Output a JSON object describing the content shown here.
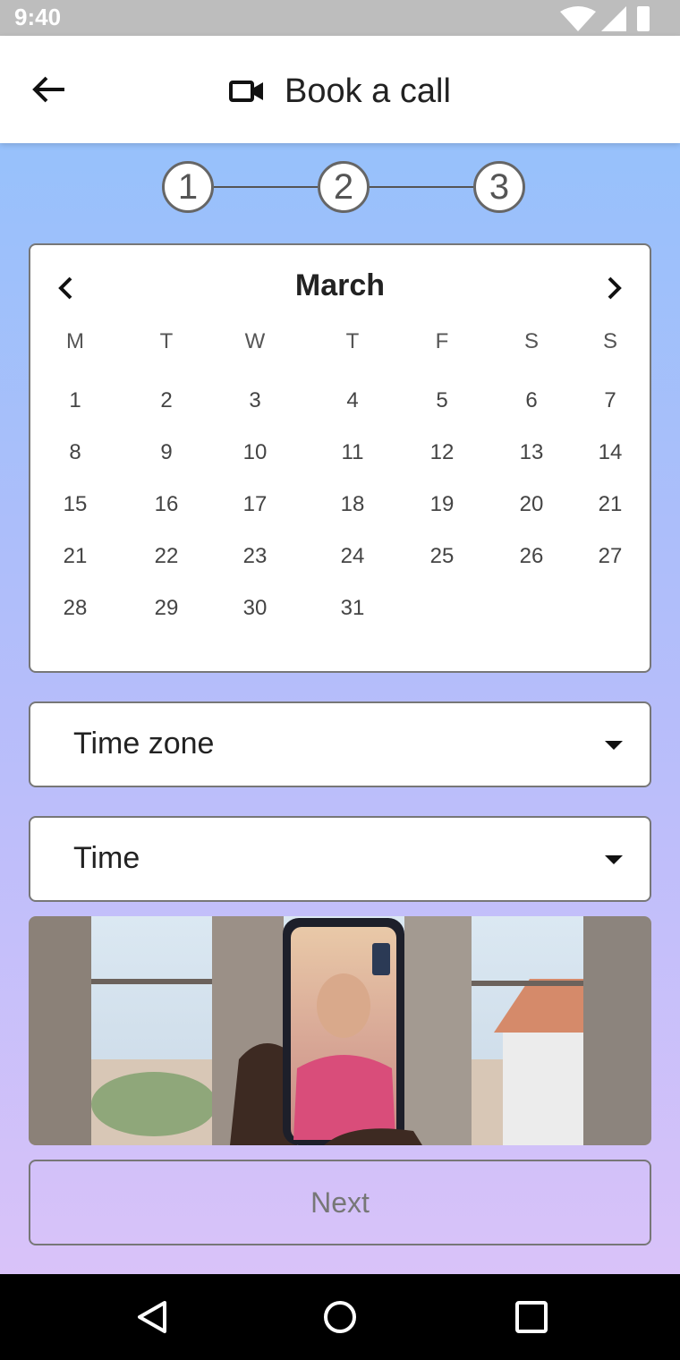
{
  "status_bar": {
    "time": "9:40",
    "icons": [
      "wifi-icon",
      "signal-icon",
      "battery-icon"
    ]
  },
  "app_bar": {
    "title": "Book a call",
    "back_icon": "arrow-left-icon",
    "title_icon": "video-camera-icon"
  },
  "stepper": {
    "steps": [
      "1",
      "2",
      "3"
    ]
  },
  "calendar": {
    "month": "March",
    "weekdays": [
      "M",
      "T",
      "W",
      "T",
      "F",
      "S",
      "S"
    ],
    "weeks": [
      [
        "1",
        "2",
        "3",
        "4",
        "5",
        "6",
        "7"
      ],
      [
        "8",
        "9",
        "10",
        "11",
        "12",
        "13",
        "14"
      ],
      [
        "15",
        "16",
        "17",
        "18",
        "19",
        "20",
        "21"
      ],
      [
        "21",
        "22",
        "23",
        "24",
        "25",
        "26",
        "27"
      ],
      [
        "28",
        "29",
        "30",
        "31"
      ]
    ]
  },
  "timezone_select": {
    "label": "Time zone"
  },
  "time_select": {
    "label": "Time"
  },
  "next_button": {
    "label": "Next"
  },
  "colors": {
    "gradient_top": "#97c1fb",
    "gradient_bottom": "#d9c2f9",
    "disabled_text": "#777777"
  }
}
